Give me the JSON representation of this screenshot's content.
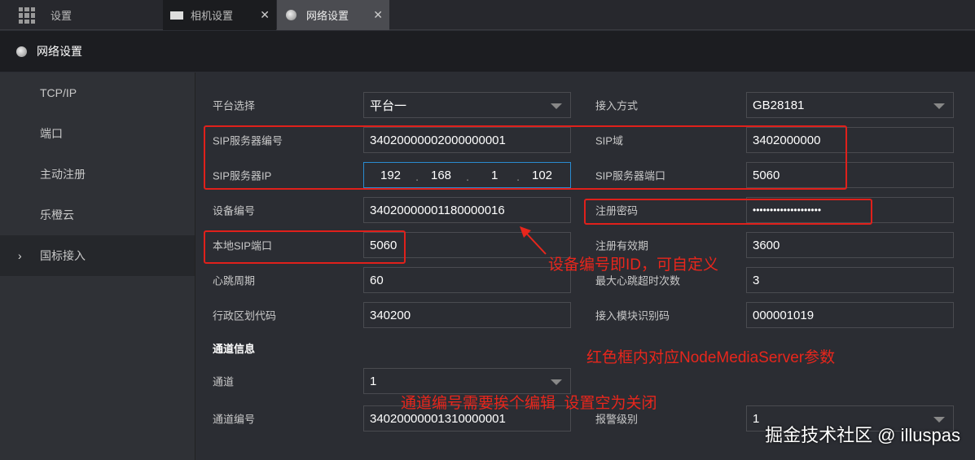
{
  "tabs": {
    "home": "设置",
    "camera": "相机设置",
    "network": "网络设置"
  },
  "header": {
    "title": "网络设置"
  },
  "sidebar": {
    "items": [
      "TCP/IP",
      "端口",
      "主动注册",
      "乐橙云",
      "国标接入"
    ]
  },
  "form": {
    "platform_label": "平台选择",
    "platform_value": "平台一",
    "access_label": "接入方式",
    "access_value": "GB28181",
    "sip_id_label": "SIP服务器编号",
    "sip_id_value": "34020000002000000001",
    "sip_domain_label": "SIP域",
    "sip_domain_value": "3402000000",
    "sip_ip_label": "SIP服务器IP",
    "sip_ip": [
      "192",
      "168",
      "1",
      "102"
    ],
    "sip_port_label": "SIP服务器端口",
    "sip_port_value": "5060",
    "device_id_label": "设备编号",
    "device_id_value": "34020000001180000016",
    "password_label": "注册密码",
    "password_value": "••••••••••••••••••••",
    "local_port_label": "本地SIP端口",
    "local_port_value": "5060",
    "expiry_label": "注册有效期",
    "expiry_value": "3600",
    "heartbeat_label": "心跳周期",
    "heartbeat_value": "60",
    "max_timeout_label": "最大心跳超时次数",
    "max_timeout_value": "3",
    "region_label": "行政区划代码",
    "region_value": "340200",
    "module_label": "接入模块识别码",
    "module_value": "000001019",
    "channel_section": "通道信息",
    "channel_label": "通道",
    "channel_value": "1",
    "channel_id_label": "通道编号",
    "channel_id_value": "34020000001310000001",
    "alarm_label": "报警级别",
    "alarm_value": "1"
  },
  "annotations": {
    "device_id": "设备编号即ID，可自定义",
    "red_box": "红色框内对应NodeMediaServer参数",
    "channel": "通道编号需要挨个编辑  设置空为关闭"
  },
  "watermark": "掘金技术社区 @ illuspas"
}
